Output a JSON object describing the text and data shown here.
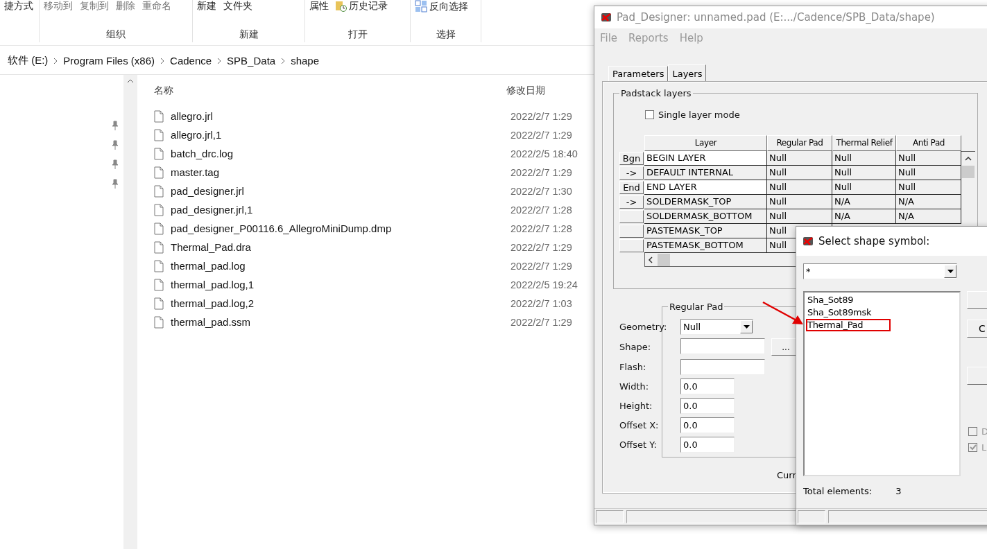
{
  "explorer": {
    "ribbon": {
      "groups": [
        {
          "items": [
            {
              "text": "捷方式",
              "icon": false
            }
          ]
        },
        {
          "label": "组织",
          "items": [
            {
              "text": "移动到",
              "icon": false
            },
            {
              "text": "复制到",
              "icon": false
            },
            {
              "text": "删除",
              "icon": false
            },
            {
              "text": "重命名",
              "icon": false
            }
          ]
        },
        {
          "label": "新建",
          "items": [
            {
              "text": "新建",
              "icon": false
            },
            {
              "text": "文件夹",
              "icon": false
            }
          ]
        },
        {
          "label": "打开",
          "items": [
            {
              "text": "属性",
              "icon": false
            },
            {
              "text": "历史记录",
              "icon": true
            }
          ]
        },
        {
          "label": "选择",
          "items": [
            {
              "text": "反向选择",
              "icon": true
            }
          ]
        }
      ]
    },
    "breadcrumb": [
      "软件 (E:)",
      "Program Files (x86)",
      "Cadence",
      "SPB_Data",
      "shape"
    ],
    "columns": [
      "名称",
      "修改日期"
    ],
    "files": [
      {
        "name": "allegro.jrl",
        "date": "2022/2/7 1:29"
      },
      {
        "name": "allegro.jrl,1",
        "date": "2022/2/7 1:29"
      },
      {
        "name": "batch_drc.log",
        "date": "2022/2/5 18:40"
      },
      {
        "name": "master.tag",
        "date": "2022/2/7 1:29"
      },
      {
        "name": "pad_designer.jrl",
        "date": "2022/2/7 1:30"
      },
      {
        "name": "pad_designer.jrl,1",
        "date": "2022/2/7 1:28"
      },
      {
        "name": "pad_designer_P00116.6_AllegroMiniDump.dmp",
        "date": "2022/2/7 1:28"
      },
      {
        "name": "Thermal_Pad.dra",
        "date": "2022/2/7 1:29"
      },
      {
        "name": "thermal_pad.log",
        "date": "2022/2/7 1:29"
      },
      {
        "name": "thermal_pad.log,1",
        "date": "2022/2/5 19:24"
      },
      {
        "name": "thermal_pad.log,2",
        "date": "2022/2/7 1:03"
      },
      {
        "name": "thermal_pad.ssm",
        "date": "2022/2/7 1:29"
      }
    ]
  },
  "pad_designer": {
    "title": "Pad_Designer: unnamed.pad (E:.../Cadence/SPB_Data/shape)",
    "menu": [
      "File",
      "Reports",
      "Help"
    ],
    "tabs": [
      {
        "label": "Parameters",
        "selected": false
      },
      {
        "label": "Layers",
        "selected": true
      }
    ],
    "layers_group": "Padstack layers",
    "single_layer_mode": {
      "label": "Single layer mode",
      "checked": false
    },
    "columns": [
      "Layer",
      "Regular Pad",
      "Thermal Relief",
      "Anti Pad"
    ],
    "rows": [
      {
        "button": "Bgn",
        "cells": [
          "BEGIN LAYER",
          "Null",
          "Null",
          "Null"
        ],
        "editable": true
      },
      {
        "button": "->",
        "cells": [
          "DEFAULT INTERNAL",
          "Null",
          "Null",
          "Null"
        ],
        "editable": false
      },
      {
        "button": "End",
        "cells": [
          "END LAYER",
          "Null",
          "Null",
          "Null"
        ],
        "editable": true
      },
      {
        "button": "->",
        "cells": [
          "SOLDERMASK_TOP",
          "Null",
          "N/A",
          "N/A"
        ],
        "editable": false
      },
      {
        "cells": [
          "SOLDERMASK_BOTTOM",
          "Null",
          "N/A",
          "N/A"
        ],
        "editable": false
      },
      {
        "cells": [
          "PASTEMASK_TOP",
          "Null"
        ],
        "editable": false
      },
      {
        "cells": [
          "PASTEMASK_BOTTOM",
          "Null"
        ],
        "editable": false
      }
    ],
    "pad_group": "Regular Pad",
    "fields": [
      {
        "label": "Geometry:",
        "kind": "select",
        "value": "Null"
      },
      {
        "label": "Shape:",
        "kind": "text",
        "button": "..."
      },
      {
        "label": "Flash:",
        "kind": "text"
      },
      {
        "label": "Width:",
        "kind": "short",
        "value": "0.0"
      },
      {
        "label": "Height:",
        "kind": "short",
        "value": "0.0"
      },
      {
        "label": "Offset X:",
        "kind": "short",
        "value": "0.0"
      },
      {
        "label": "Offset Y:",
        "kind": "short",
        "value": "0.0"
      }
    ],
    "current_label": "Curr"
  },
  "select_dialog": {
    "title": "Select shape symbol:",
    "filter": "*",
    "symbols": [
      {
        "name": "Sha_Sot89",
        "annotated": false
      },
      {
        "name": "Sha_Sot89msk",
        "annotated": false
      },
      {
        "name": "Thermal_Pad",
        "annotated": true
      }
    ],
    "side_buttons": [
      {
        "kind": "blank"
      },
      {
        "kind": "text",
        "label": "C"
      },
      {
        "kind": "blank"
      }
    ],
    "options": [
      {
        "label": "D",
        "checked": false
      },
      {
        "label": "L",
        "checked": true
      }
    ],
    "total_label": "Total elements:",
    "total": "3"
  }
}
